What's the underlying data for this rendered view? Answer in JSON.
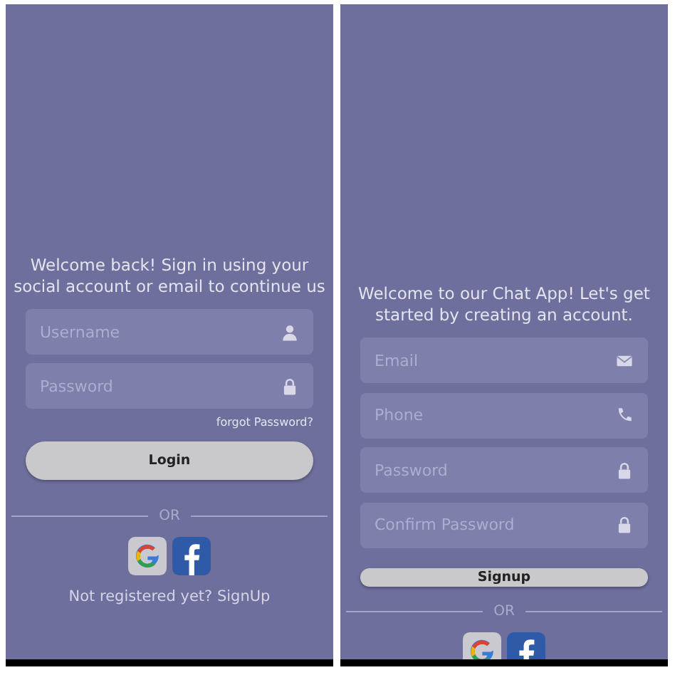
{
  "screens": [
    {
      "intro": "Welcome back! Sign in using your social account or email to continue us",
      "fields": [
        {
          "placeholder": "Username",
          "kind": "user"
        },
        {
          "placeholder": "Password",
          "kind": "lock"
        }
      ],
      "link": "forgot Password?",
      "button": "Login",
      "divider": "OR",
      "footer": "Not registered yet? SignUp"
    },
    {
      "intro": "Welcome to our Chat App! Let's get started by creating an account.",
      "fields": [
        {
          "placeholder": "Email",
          "kind": "mail"
        },
        {
          "placeholder": "Phone",
          "kind": "phone"
        },
        {
          "placeholder": "Password",
          "kind": "lock"
        },
        {
          "placeholder": "Confirm Password",
          "kind": "lock"
        }
      ],
      "button": "Signup",
      "divider": "OR"
    }
  ]
}
